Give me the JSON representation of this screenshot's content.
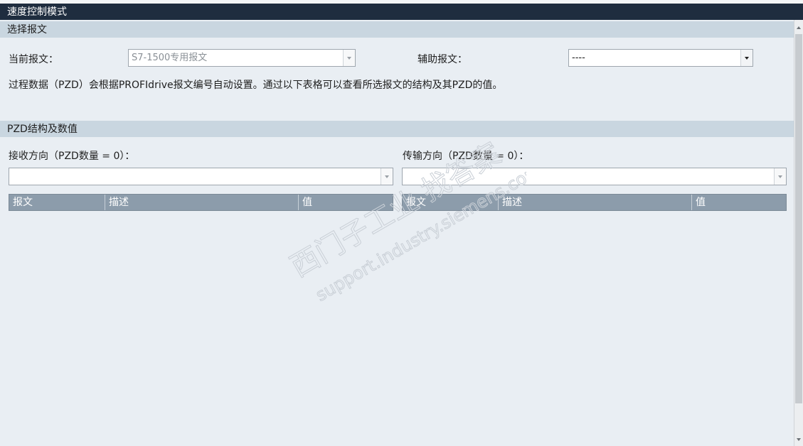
{
  "window": {
    "title": "速度控制模式"
  },
  "select_section": {
    "header": "选择报文",
    "current_label": "当前报文：",
    "current_value": "S7-1500专用报文",
    "aux_label": "辅助报文：",
    "aux_value": "----",
    "info": "过程数据（PZD）会根据PROFIdrive报文编号自动设置。通过以下表格可以查看所选报文的结构及其PZD的值。"
  },
  "pzd_section": {
    "header": "PZD结构及数值",
    "receive": {
      "label": "接收方向（PZD数量 = 0）：",
      "selector_value": ""
    },
    "transmit": {
      "label": "传输方向（PZD数量 = 0）：",
      "selector_value": ""
    },
    "columns": [
      "报文",
      "描述",
      "值"
    ]
  },
  "watermark": {
    "line1": "西门子工业 找答案",
    "line2": "support.industry.siemens.com/cs"
  },
  "colors": {
    "titlebar": "#1f2d3f",
    "section": "#c9d6e0",
    "table_header": "#8c9cab",
    "background": "#e9eef3"
  }
}
